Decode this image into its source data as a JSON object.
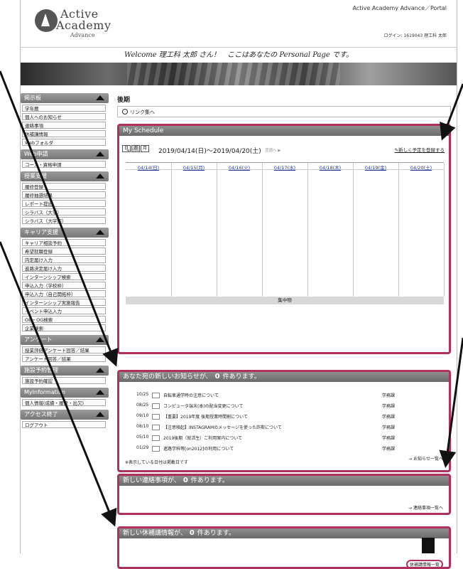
{
  "header": {
    "logo_line1": "Active",
    "logo_line2": "Academy",
    "logo_line3": "Advance",
    "portal_title": "Active Academy Advance／Portal",
    "login_text": "ログイン: 1619043 理工科 太郎",
    "welcome": "Welcome 理工科 太郎 さん！　ここはあなたの Personal Page です。"
  },
  "sidebar": [
    {
      "title": "掲示板",
      "items": [
        "学年暦",
        "個人へのお知らせ",
        "連絡事項",
        "休補講情報",
        "Webフォルダ"
      ]
    },
    {
      "title": "Web申請",
      "items": [
        "コース・資格申請"
      ]
    },
    {
      "title": "授業支援",
      "items": [
        "履修登録",
        "履修抽選結果",
        "レポート提出",
        "シラバス（大学）",
        "シラバス（大学院）"
      ]
    },
    {
      "title": "キャリア支援",
      "items": [
        "キャリア相談予約",
        "希望就職登録",
        "内定届け入力",
        "進路決定届け入力",
        "インターンシップ検索",
        "申込入力（学校枠）",
        "申込入力（自己開拓枠）",
        "インターンシップ実施報告",
        "イベント申込入力",
        "OB・OG検索",
        "企業検索"
      ]
    },
    {
      "title": "アンケート",
      "items": [
        "授業評価アンケート回答／結果",
        "アンケート回答／結果"
      ]
    },
    {
      "title": "施設予約管理",
      "items": [
        "施設予約確認"
      ]
    },
    {
      "title": "MyInformation",
      "items": [
        "個人情報(成績・履修・出欠)"
      ]
    },
    {
      "title": "アクセス終了",
      "items": [
        "ログアウト"
      ]
    }
  ],
  "main": {
    "term": "後期",
    "link_label": "リンク集へ",
    "schedule": {
      "title": "My Schedule",
      "tabs": [
        "日",
        "週",
        "月"
      ],
      "prev": "先週へ",
      "range": "2019/04/14(日)～2019/04/20(土)",
      "next": "翌週へ",
      "new_schedule": "新しく予定を登録する",
      "days": [
        "04/14(日)",
        "04/15(月)",
        "04/16(火)",
        "04/17(水)",
        "04/18(木)",
        "04/19(金)",
        "04/20(土)"
      ],
      "status": "集中物"
    },
    "notices": {
      "title_pre": "あなた宛の新しいお知らせが、",
      "count": "0",
      "title_post": "件あります。",
      "rows": [
        {
          "date": "10/25",
          "title": "自転車通学時の注意について",
          "sender": "学務課"
        },
        {
          "date": "08/25",
          "title": "コンピュータ端末(本)の配当変更について",
          "sender": "学務課"
        },
        {
          "date": "09/10",
          "title": "【重要】2019年度 後期授業時間割について",
          "sender": "学務課"
        },
        {
          "date": "08/10",
          "title": "【注意喚起】INSTAGRAMのメッセージを使った詐欺について",
          "sender": "学務課"
        },
        {
          "date": "05/10",
          "title": "2019後期（就活生）ご利用案内について",
          "sender": "学務課"
        },
        {
          "date": "01/29",
          "date2": "",
          "title": "進路学科等[on2012]の利用について",
          "sender": "学務課"
        }
      ],
      "footnote": "※表示している日付は掲載日です",
      "more": "お知らせ一覧へ"
    },
    "contacts": {
      "title_pre": "新しい連絡事項が、",
      "count": "0",
      "title_post": "件あります。",
      "more": "連絡事項一覧へ"
    },
    "classes": {
      "title_pre": "新しい休補講情報が、",
      "count": "0",
      "title_post": "件あります。",
      "more": "休補講情報一覧"
    }
  }
}
